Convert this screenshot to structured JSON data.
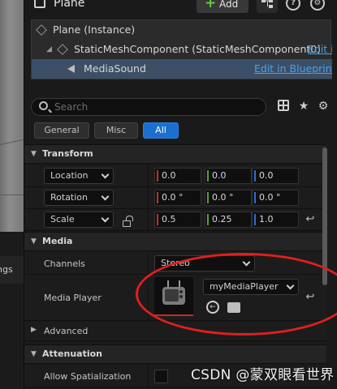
{
  "viewport": {
    "side_tab_label": "ngs"
  },
  "header": {
    "title": "Plane",
    "add_label": "Add",
    "plus_glyph": "+",
    "help_glyph": "?",
    "settings_glyph": "⚙"
  },
  "tree": {
    "root": "Plane (Instance)",
    "component": "StaticMeshComponent (StaticMeshComponent0)",
    "component_edit": "Edit i",
    "selected": "MediaSound",
    "selected_edit": "Edit in Blueprint"
  },
  "search": {
    "placeholder": "Search",
    "value": ""
  },
  "tabs": [
    "General",
    "Misc",
    "All"
  ],
  "active_tab": "All",
  "sections": {
    "transform": "Transform",
    "media": "Media",
    "advanced": "Advanced",
    "attenuation": "Attenuation"
  },
  "transform": {
    "location": {
      "label": "Location",
      "x": "0.0",
      "y": "0.0",
      "z": "0.0"
    },
    "rotation": {
      "label": "Rotation",
      "x": "0.0 °",
      "y": "0.0 °",
      "z": "0.0 °"
    },
    "scale": {
      "label": "Scale",
      "x": "0.5",
      "y": "0.25",
      "z": "1.0"
    }
  },
  "media": {
    "channels_label": "Channels",
    "channels_value": "Stereo",
    "player_label": "Media Player",
    "player_value": "myMediaPlayer"
  },
  "attenuation": {
    "allow_spatialization_label": "Allow Spatialization",
    "allow_spatialization": false
  },
  "watermark": "CSDN @蒙双眼看世界",
  "colors": {
    "accent": "#1b6fd0",
    "link": "#4ca1e6",
    "selection": "#3c4f66",
    "annotation": "#e01f1f"
  }
}
